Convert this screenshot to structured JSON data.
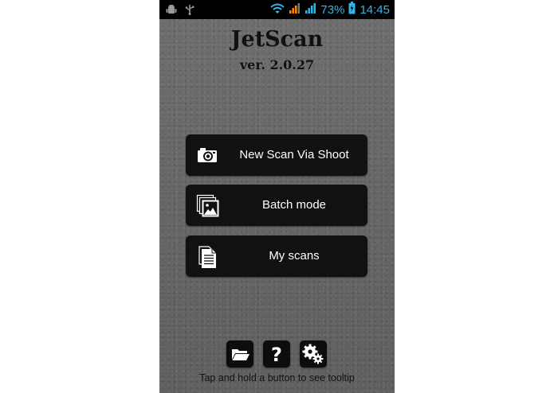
{
  "status_bar": {
    "icons_left": [
      "android-debug-icon",
      "usb-icon"
    ],
    "icons_right": [
      "wifi-icon",
      "signal-icon-1",
      "signal-icon-2",
      "battery-icon"
    ],
    "battery_percent": "73%",
    "time": "14:45",
    "accent_color": "#33b5e5"
  },
  "app": {
    "title": "JetScan",
    "version": "ver. 2.0.27"
  },
  "buttons": [
    {
      "label": "New Scan Via Shoot",
      "icon": "camera-icon"
    },
    {
      "label": "Batch mode",
      "icon": "image-stack-icon"
    },
    {
      "label": "My scans",
      "icon": "documents-icon"
    }
  ],
  "toolbar": {
    "icons": [
      "folder-icon",
      "help-icon",
      "settings-icon"
    ],
    "hint": "Tap and hold a button to see tooltip"
  }
}
